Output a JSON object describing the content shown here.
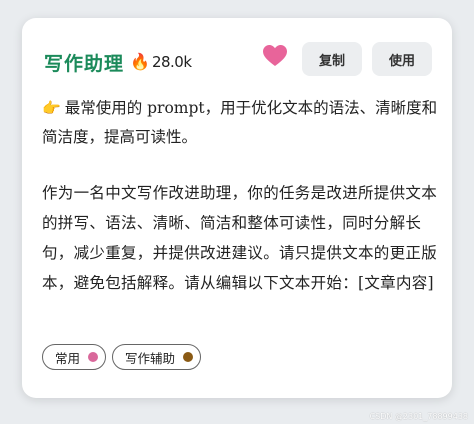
{
  "card": {
    "title": "写作助理",
    "fire_icon": "fire-icon",
    "count": "28.0k",
    "heart_icon": "heart-icon",
    "heart_color": "#e8649a",
    "buttons": {
      "copy_label": "复制",
      "use_label": "使用"
    },
    "description_icon": "pointing-hand-icon",
    "description": "最常使用的 prompt，用于优化文本的语法、清晰度和简洁度，提高可读性。",
    "prompt": "作为一名中文写作改进助理，你的任务是改进所提供文本的拼写、语法、清晰、简洁和整体可读性，同时分解长句，减少重复，并提供改进建议。请只提供文本的更正版本，避免包括解释。请从编辑以下文本开始：[文章内容]",
    "tags": [
      {
        "label": "常用",
        "color": "#d9689b"
      },
      {
        "label": "写作辅助",
        "color": "#8a5a14"
      }
    ]
  },
  "watermark": "CSDN @2301_78899438"
}
